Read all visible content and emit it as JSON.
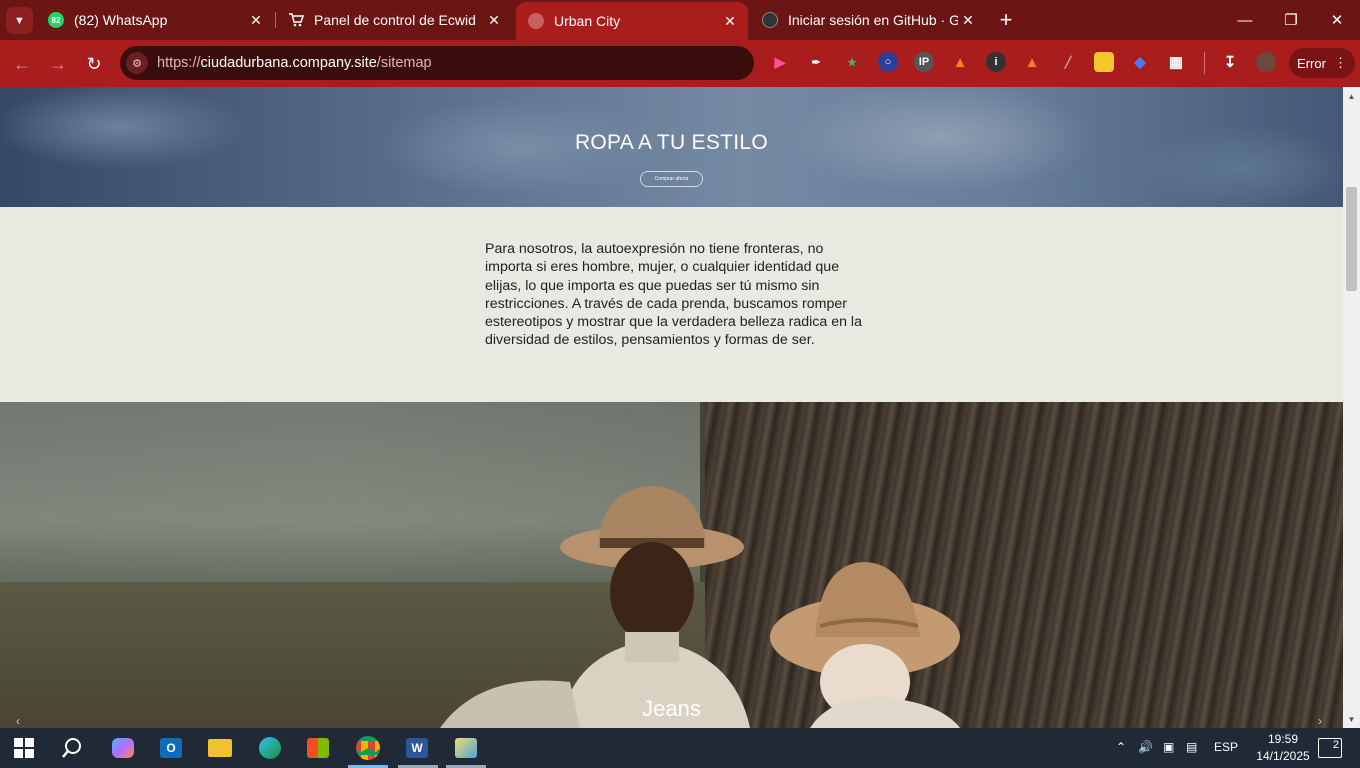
{
  "browser": {
    "tabs": [
      {
        "title": "(82) WhatsApp",
        "badge": "82",
        "icon": "whatsapp-icon",
        "color": "#25d366"
      },
      {
        "title": "Panel de control de Ecwid",
        "icon": "cart-icon",
        "color": "#ffffff"
      },
      {
        "title": "Urban City",
        "icon": "globe-icon",
        "color": "#c86060",
        "active": true
      },
      {
        "title": "Iniciar sesión en GitHub · GitHub",
        "icon": "github-icon",
        "color": "#333333"
      }
    ],
    "url": {
      "scheme": "https://",
      "host": "ciudadurbana.company.site",
      "path": "/sitemap"
    },
    "profile_status": "Error",
    "accent": "#a91d1d"
  },
  "page": {
    "hero": {
      "title": "ROPA A TU ESTILO",
      "button": "Comprar ahora"
    },
    "intro": "Para nosotros, la autoexpresión no tiene fronteras, no importa si eres hombre, mujer, o cualquier identidad que elijas, lo que importa es que puedas ser tú mismo sin restricciones. A través de cada prenda, buscamos romper estereotipos y mostrar que la verdadera belleza radica en la diversidad de estilos, pensamientos y formas de ser.",
    "banner_caption": "Jeans"
  },
  "taskbar": {
    "language": "ESP",
    "time": "19:59",
    "date": "14/1/2025",
    "notifications": "2"
  }
}
